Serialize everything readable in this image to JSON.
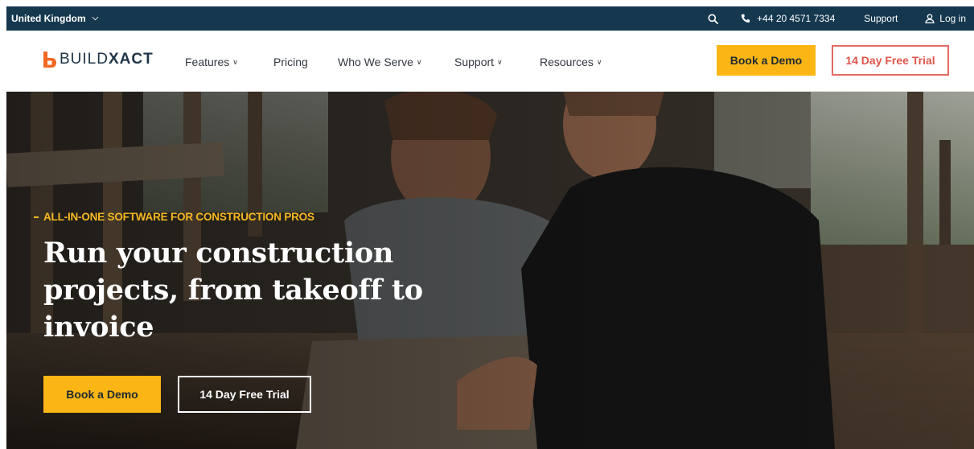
{
  "topbar": {
    "region": "United Kingdom",
    "phone": "+44 20 4571 7334",
    "support": "Support",
    "login": "Log in",
    "icons": [
      "chevron-down-icon",
      "search-icon",
      "phone-icon",
      "user-icon"
    ]
  },
  "brand": {
    "name_bold": "BUILD",
    "name_regular": "XACT",
    "accent_color": "#f26722"
  },
  "nav": {
    "items": [
      {
        "label": "Features",
        "has_dropdown": true
      },
      {
        "label": "Pricing",
        "has_dropdown": false
      },
      {
        "label": "Who We Serve",
        "has_dropdown": true
      },
      {
        "label": "Support",
        "has_dropdown": true
      },
      {
        "label": "Resources",
        "has_dropdown": true
      }
    ],
    "book_demo": "Book a Demo",
    "free_trial": "14 Day Free Trial"
  },
  "hero": {
    "eyebrow": "ALL-IN-ONE SOFTWARE FOR CONSTRUCTION PROS",
    "headline": "Run your construction projects, from takeoff to invoice",
    "book_demo": "Book a Demo",
    "free_trial": "14 Day Free Trial"
  },
  "colors": {
    "topbar_bg": "#15384f",
    "cta_yellow": "#fbb615",
    "trial_outline": "#e26b62",
    "eyebrow": "#f5b820"
  }
}
